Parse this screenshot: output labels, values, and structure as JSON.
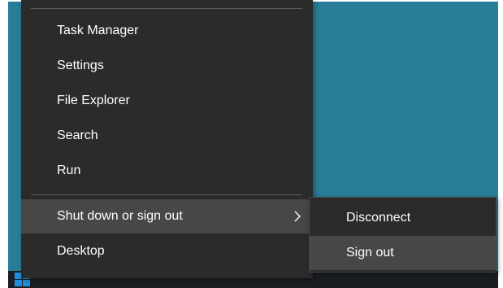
{
  "menu": {
    "items": [
      {
        "label": "Task Manager"
      },
      {
        "label": "Settings"
      },
      {
        "label": "File Explorer"
      },
      {
        "label": "Search"
      },
      {
        "label": "Run"
      },
      {
        "label": "Shut down or sign out",
        "has_submenu": true,
        "highlighted": true
      },
      {
        "label": "Desktop"
      }
    ]
  },
  "submenu": {
    "items": [
      {
        "label": "Disconnect"
      },
      {
        "label": "Sign out",
        "highlighted": true
      }
    ]
  },
  "colors": {
    "desktop": "#2a7d98",
    "menu_bg": "#2b2b2b",
    "highlight": "#474747",
    "text": "#ffffff",
    "taskbar": "#1a1d22"
  },
  "icons": {
    "submenu_arrow": "chevron-right-icon",
    "start": "windows-logo-icon"
  }
}
